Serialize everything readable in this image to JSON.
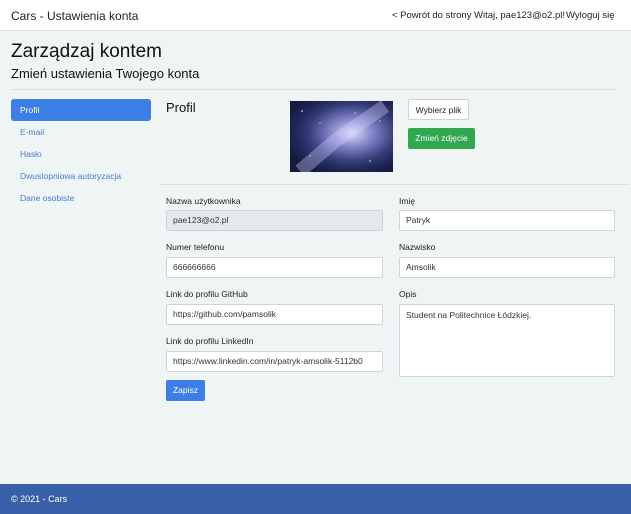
{
  "navbar": {
    "brand": "Cars - Ustawienia konta",
    "back_link": "< Powrót do strony",
    "greeting": "Witaj, pae123@o2.pl!",
    "logout": "Wyloguj się"
  },
  "page": {
    "title": "Zarządzaj kontem",
    "subtitle": "Zmień ustawienia Twojego konta"
  },
  "sidebar": {
    "items": [
      {
        "label": "Profil"
      },
      {
        "label": "E-mail"
      },
      {
        "label": "Hasło"
      },
      {
        "label": "Dwustopniowa autoryzacja"
      },
      {
        "label": "Dane osobiste"
      }
    ]
  },
  "profile": {
    "section_title": "Profil",
    "choose_file_label": "Wybierz plik",
    "change_photo_label": "Zmień zdjęcie",
    "fields": {
      "username": {
        "label": "Nazwa użytkownika",
        "value": "pae123@o2.pl"
      },
      "phone": {
        "label": "Numer telefonu",
        "value": "666666666"
      },
      "github": {
        "label": "Link do profilu GitHub",
        "value": "https://github.com/pamsolik"
      },
      "linkedin": {
        "label": "Link do profilu LinkedIn",
        "value": "https://www.linkedin.com/in/patryk-amsolik-5112b0"
      },
      "first_name": {
        "label": "Imię",
        "value": "Patryk"
      },
      "last_name": {
        "label": "Nazwisko",
        "value": "Amsolik"
      },
      "description": {
        "label": "Opis",
        "value": "Student na Politechnice Łódzkiej."
      }
    },
    "save_label": "Zapisz"
  },
  "footer": {
    "text": "© 2021 - Cars"
  },
  "colors": {
    "primary": "#3c7de6",
    "success": "#2fa84f",
    "footer_bg": "#3a5fa9",
    "page_bg": "#eef5f4"
  }
}
